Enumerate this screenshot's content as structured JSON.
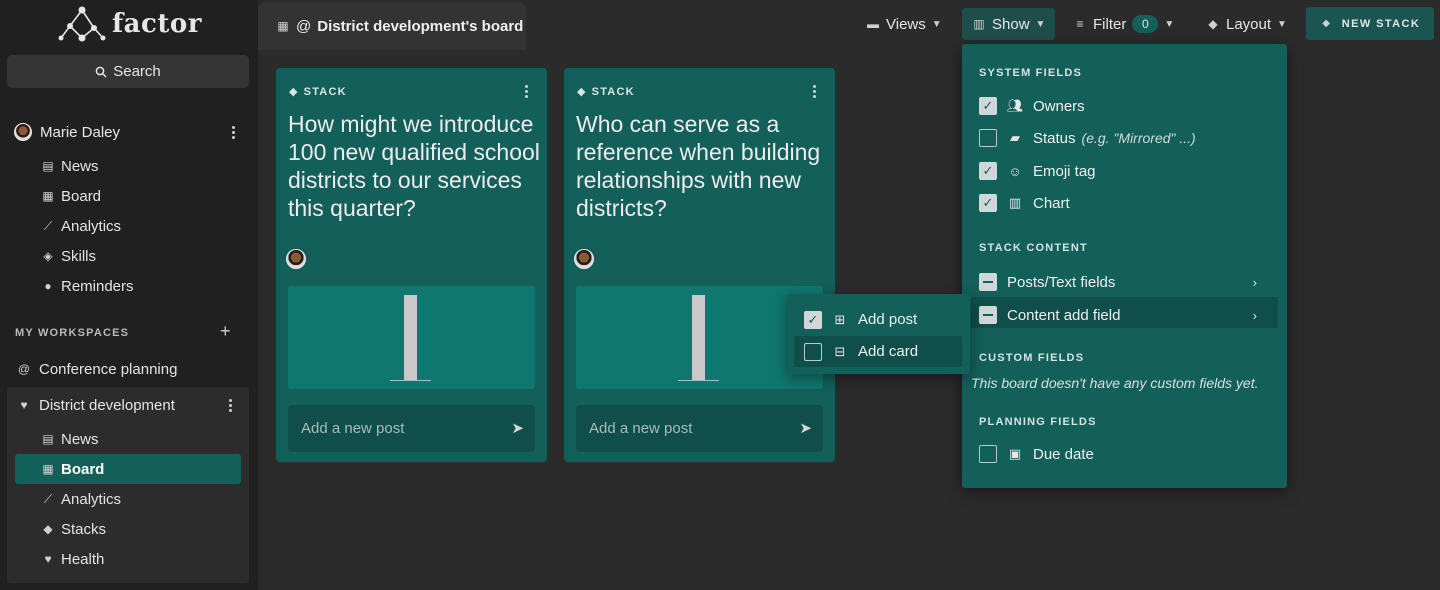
{
  "app": {
    "logo_text": "factor"
  },
  "sidebar": {
    "search_label": "Search",
    "user": {
      "name": "Marie Daley"
    },
    "user_nav": [
      {
        "label": "News",
        "icon": "newspaper-icon"
      },
      {
        "label": "Board",
        "icon": "board-grid-icon"
      },
      {
        "label": "Analytics",
        "icon": "analytics-chart-icon"
      },
      {
        "label": "Skills",
        "icon": "graduation-cap-icon"
      },
      {
        "label": "Reminders",
        "icon": "bell-icon"
      }
    ],
    "workspaces_label": "MY WORKSPACES",
    "workspaces": [
      {
        "label": "Conference planning",
        "icon": "at-icon"
      },
      {
        "label": "District development",
        "icon": "heartbeat-icon"
      }
    ],
    "district_nav": [
      {
        "label": "News",
        "icon": "newspaper-icon",
        "active": false
      },
      {
        "label": "Board",
        "icon": "board-grid-icon",
        "active": true
      },
      {
        "label": "Analytics",
        "icon": "analytics-chart-icon",
        "active": false
      },
      {
        "label": "Stacks",
        "icon": "layers-icon",
        "active": false
      },
      {
        "label": "Health",
        "icon": "heartbeat-icon",
        "active": false
      }
    ]
  },
  "header": {
    "board_tab": "District development's board",
    "views_label": "Views",
    "show_label": "Show",
    "filter_label": "Filter",
    "filter_count": "0",
    "layout_label": "Layout",
    "new_stack_label": "NEW STACK"
  },
  "stacks": [
    {
      "tag": "STACK",
      "title": "How might we introduce 100 new qualified school districts to our services this quarter?",
      "add_post_placeholder": "Add a new post"
    },
    {
      "tag": "STACK",
      "title": "Who can serve as a reference when building relationships with new districts?",
      "add_post_placeholder": "Add a new post"
    }
  ],
  "show_menu": {
    "system_fields_label": "SYSTEM FIELDS",
    "system_fields": [
      {
        "label": "Owners",
        "hint": "",
        "checked": true,
        "icon": "users-icon"
      },
      {
        "label": "Status",
        "hint": "(e.g. \"Mirrored\" ...)",
        "checked": false,
        "icon": "tag-icon"
      },
      {
        "label": "Emoji tag",
        "hint": "",
        "checked": true,
        "icon": "smiley-icon"
      },
      {
        "label": "Chart",
        "hint": "",
        "checked": true,
        "icon": "chart-icon"
      }
    ],
    "stack_content_label": "STACK CONTENT",
    "stack_content": [
      {
        "label": "Posts/Text fields"
      },
      {
        "label": "Content add field"
      }
    ],
    "custom_fields_label": "CUSTOM FIELDS",
    "custom_fields_empty": "This board doesn't have any custom fields yet.",
    "planning_fields_label": "PLANNING FIELDS",
    "planning_fields": [
      {
        "label": "Due date",
        "checked": false,
        "icon": "calendar-icon"
      }
    ]
  },
  "submenu": [
    {
      "label": "Add post",
      "checked": true,
      "icon": "add-post-icon"
    },
    {
      "label": "Add card",
      "checked": false,
      "icon": "add-card-icon"
    }
  ],
  "colors": {
    "teal": "#135f5a",
    "teal_dark": "#0f4e4a",
    "background": "#2b2b2b",
    "sidebar": "#202020"
  }
}
